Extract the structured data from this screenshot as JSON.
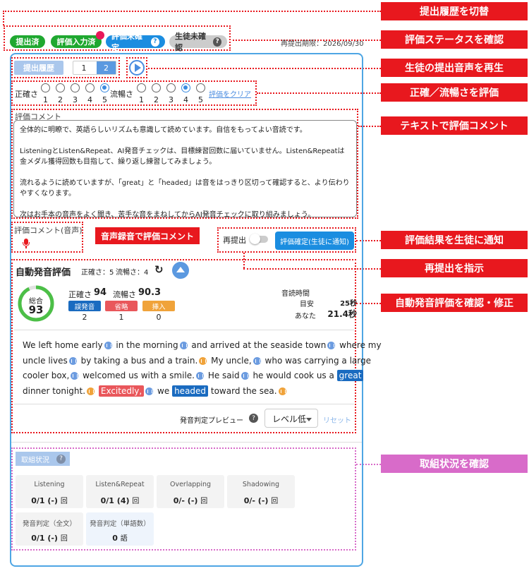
{
  "status": {
    "submitted": "提出済",
    "eval_input": "評価入力済",
    "eval_unconfirmed": "評価未確定",
    "student_unconfirmed": "生徒未確認",
    "deadline": "再提出期限：2026/09/30",
    "help_icon": "?"
  },
  "history": {
    "button": "提出履歴",
    "page1": "1",
    "page2": "2"
  },
  "rating": {
    "accuracy_label": "正確さ",
    "fluency_label": "流暢さ",
    "scale": [
      "1",
      "2",
      "3",
      "4",
      "5"
    ],
    "accuracy_selected": 5,
    "fluency_selected": 4,
    "clear": "評価をクリア"
  },
  "comment": {
    "label": "評価コメント",
    "paragraphs": [
      "全体的に明瞭で、英語らしいリズムも意識して読めています。自信をもってよい音読です。",
      "ListeningとListen&Repeat、AI発音チェックは、目標練習回数に届いていません。Listen&Repeatは金メダル獲得回数も目指して、繰り返し練習してみましょう。",
      "流れるように読めていますが、「great」と「headed」は音をはっきり区切って確認すると、より伝わりやすくなります。",
      "次はお手本の音声をよく聞き、苦手な音をまねしてからAI発音チェックに取り組みましょう。"
    ],
    "voice_label": "評価コメント(音声)",
    "resubmit_label": "再提出",
    "confirm_button": "評価確定(生徒に通知)"
  },
  "auto": {
    "title": "自動発音評価",
    "accuracy": "正確さ：5",
    "fluency": "流暢さ：4",
    "total_label": "総合",
    "total": "93",
    "total_pct": 93,
    "acc_label": "正確さ",
    "acc_value": "94",
    "flu_label": "流暢さ",
    "flu_value": "90.3",
    "tags": [
      {
        "label": "誤発音",
        "count": "2",
        "color": "#1a6bc0"
      },
      {
        "label": "省略",
        "count": "1",
        "color": "#e9575b"
      },
      {
        "label": "挿入",
        "count": "0",
        "color": "#f0a33a"
      }
    ],
    "time_label": "音読時間",
    "guide_label": "目安",
    "guide_value": "25秒",
    "you_label": "あなた",
    "you_value": "21.4秒",
    "preview_label": "発音判定プレビュー",
    "level": "レベル低",
    "reset": "リセット"
  },
  "passage": {
    "l1a": "We left home early",
    "l1b": "in the morning",
    "l1c": "and arrived at the seaside town",
    "l1d": "where my",
    "l2a": "uncle lives",
    "l2b": "by taking a bus and a train.",
    "l2c": "My uncle,",
    "l2d": "who was carrying a large",
    "l3a": "cooler box,",
    "l3b": "welcomed us with a smile.",
    "l3c": "He said",
    "l3d": "he would cook us a",
    "l3e": "great",
    "l4a": "dinner tonight.",
    "l4b": "Excitedly,",
    "l4c": "we",
    "l4d": "headed",
    "l4e": "toward the sea."
  },
  "progress": {
    "title": "取組状況",
    "tiles": [
      {
        "title": "Listening",
        "value": "0/1 (-)",
        "unit": "回"
      },
      {
        "title": "Listen&Repeat",
        "value": "0/1 (4)",
        "unit": "回"
      },
      {
        "title": "Overlapping",
        "value": "0/- (-)",
        "unit": "回"
      },
      {
        "title": "Shadowing",
        "value": "0/- (-)",
        "unit": "回"
      },
      {
        "title": "発音判定（全文）",
        "value": "0/1 (-)",
        "unit": "回"
      },
      {
        "title": "発音判定（単語数）",
        "value": "0",
        "unit": "語"
      }
    ]
  },
  "callouts": {
    "c1": "提出履歴を切替",
    "c2": "評価ステータスを確認",
    "c3": "生徒の提出音声を再生",
    "c4": "正確／流暢さを評価",
    "c5": "テキストで評価コメント",
    "c6": "音声録音で評価コメント",
    "c7": "評価結果を生徒に通知",
    "c8": "再提出を指示",
    "c9": "自動発音評価を確認・修正",
    "c10": "取組状況を確認"
  },
  "colors": {
    "red": "#e8181e",
    "pink": "#d86bc9",
    "blue": "#4ea6e4",
    "green": "#1fa830"
  }
}
